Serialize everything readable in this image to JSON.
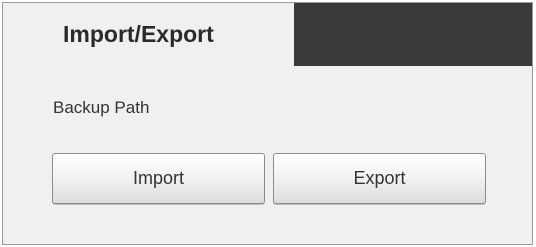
{
  "tabs": [
    {
      "label": "Import/Export",
      "active": true
    }
  ],
  "backup_path": {
    "label": "Backup Path"
  },
  "buttons": {
    "import_label": "Import",
    "export_label": "Export"
  },
  "colors": {
    "tabbar_background": "#3a3a3a",
    "panel_background": "#f0f0f0"
  }
}
